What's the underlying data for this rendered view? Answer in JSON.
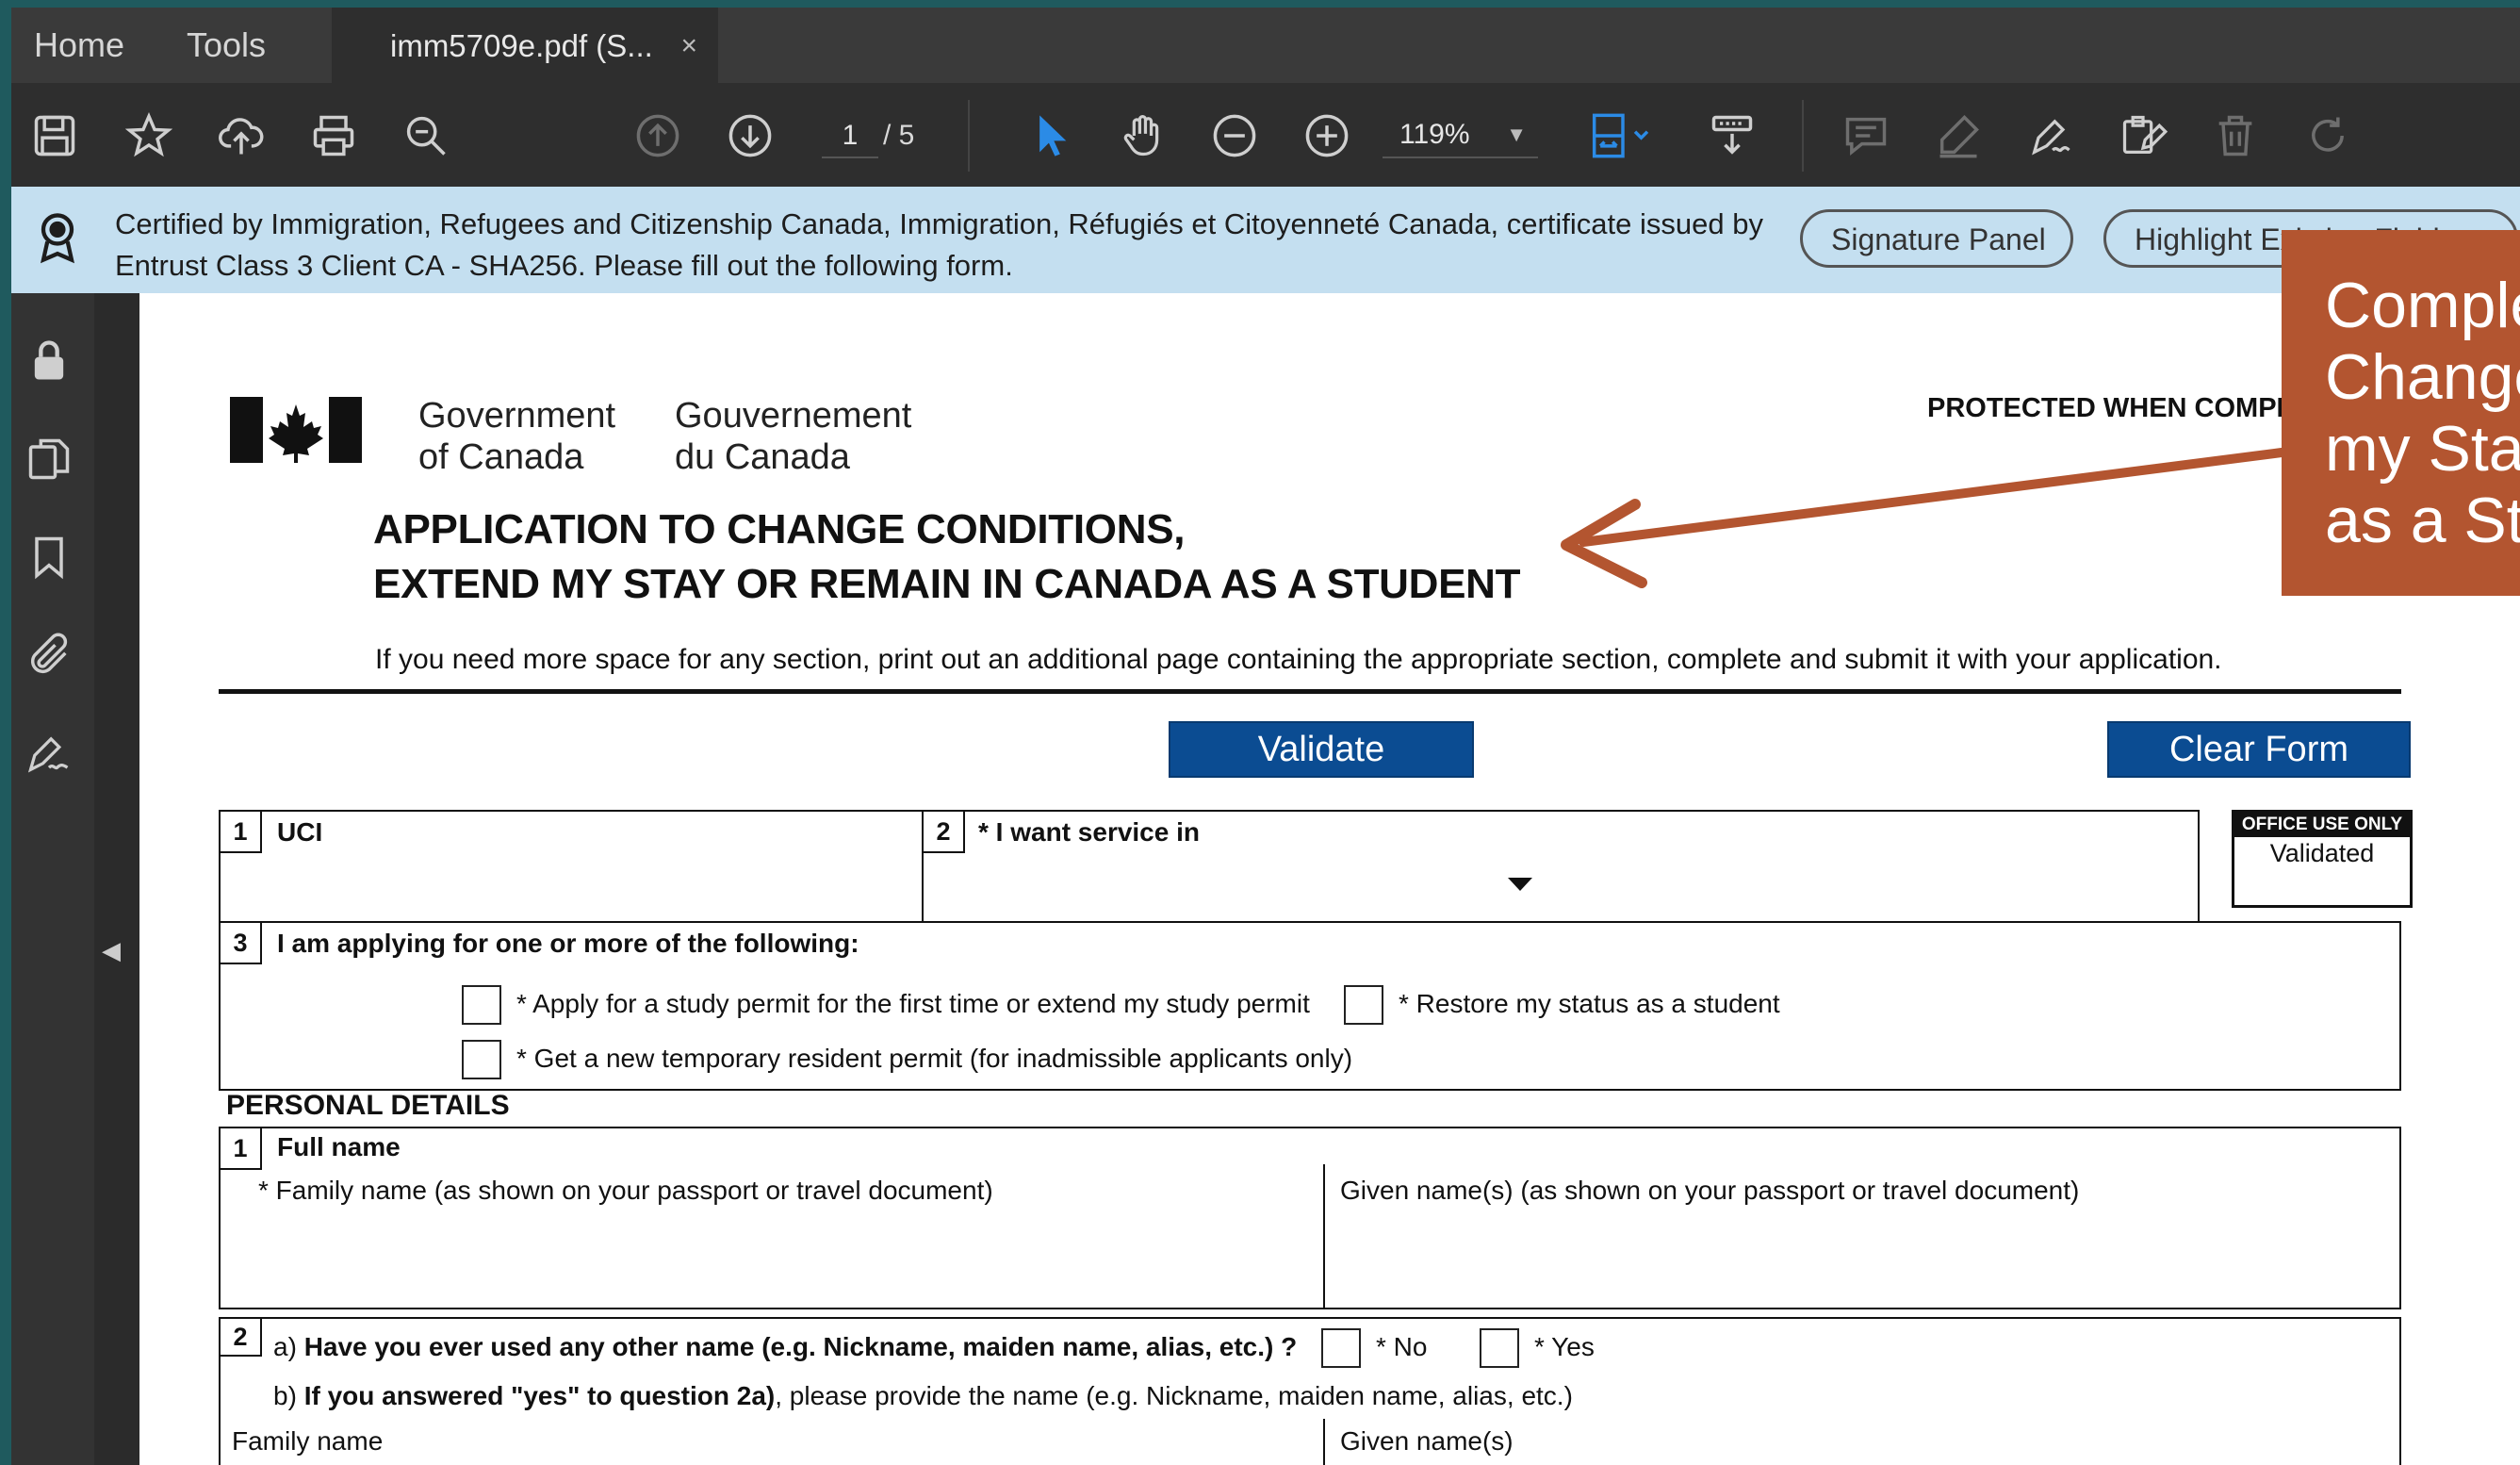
{
  "tabs": {
    "home": "Home",
    "tools": "Tools",
    "document": "imm5709e.pdf (S...",
    "close": "×"
  },
  "toolbar": {
    "page_current": "1",
    "page_total": "/ 5",
    "zoom": "119%",
    "icons": [
      "save-icon",
      "star-icon",
      "cloud-upload-icon",
      "print-icon",
      "zoom-search-icon",
      "page-up-icon",
      "page-down-icon",
      "select-arrow-icon",
      "hand-icon",
      "zoom-out-icon",
      "zoom-in-icon",
      "fit-page-icon",
      "scroll-mode-icon",
      "comment-icon",
      "highlight-icon",
      "sign-icon",
      "edit-icon",
      "delete-icon",
      "undo-icon"
    ]
  },
  "notice": {
    "text": "Certified by Immigration, Refugees and Citizenship Canada, Immigration, Réfugiés et Citoyenneté Canada, certificate issued by Entrust Class 3 Client CA - SHA256.  Please fill out the following form.",
    "signature_panel": "Signature Panel",
    "highlight_fields": "Highlight Existing Fields"
  },
  "rail": {
    "icons": [
      "lock-icon",
      "pages-icon",
      "bookmark-icon",
      "attachment-icon",
      "signature-icon"
    ]
  },
  "document": {
    "gov_en_1": "Government",
    "gov_en_2": "of Canada",
    "gov_fr_1": "Gouvernement",
    "gov_fr_2": "du Canada",
    "protected": "PROTECTED WHEN COMPLETED - B",
    "title_1": "APPLICATION TO CHANGE CONDITIONS,",
    "title_2": "EXTEND MY STAY OR REMAIN IN CANADA AS A STUDENT",
    "subnote": "If you need more space for any section, print out an additional page containing the appropriate section, complete and submit it with your application.",
    "validate_button": "Validate",
    "clear_button": "Clear Form",
    "q1_num": "1",
    "q1_label": "UCI",
    "q2_num": "2",
    "q2_label": "* I want service in",
    "office_use": "OFFICE USE ONLY",
    "validated": "Validated",
    "q3_num": "3",
    "q3_label": "I am applying for one or more of the following:",
    "opt_study": "*  Apply for a study permit for the first time or extend my study permit",
    "opt_restore": "* Restore my status as a student",
    "opt_trp": "* Get a new temporary resident permit (for inadmissible applicants only)",
    "personal_details": "PERSONAL DETAILS",
    "pd1_num": "1",
    "pd1_label": "Full name",
    "family_name_label": "* Family name (as shown on your passport or travel document)",
    "given_name_label": "Given name(s) (as shown on your passport or travel document)",
    "pd2_num": "2",
    "q2a_prefix": "a) ",
    "q2a_bold": "Have you ever used any other name (e.g. Nickname, maiden name, alias, etc.) ?",
    "q2a_no": "* No",
    "q2a_yes": "* Yes",
    "q2b_prefix": "b) ",
    "q2b_bold": "If you answered \"yes\" to question 2a)",
    "q2b_rest": ", please provide the name (e.g. Nickname, maiden name, alias, etc.)",
    "family_name_short": "Family name",
    "given_name_short": "Given name(s)"
  },
  "annotation": {
    "line1": "Complete",
    "line2": "Change",
    "line3": "my Status",
    "line4": "as a Student",
    "color": "#b35530"
  }
}
